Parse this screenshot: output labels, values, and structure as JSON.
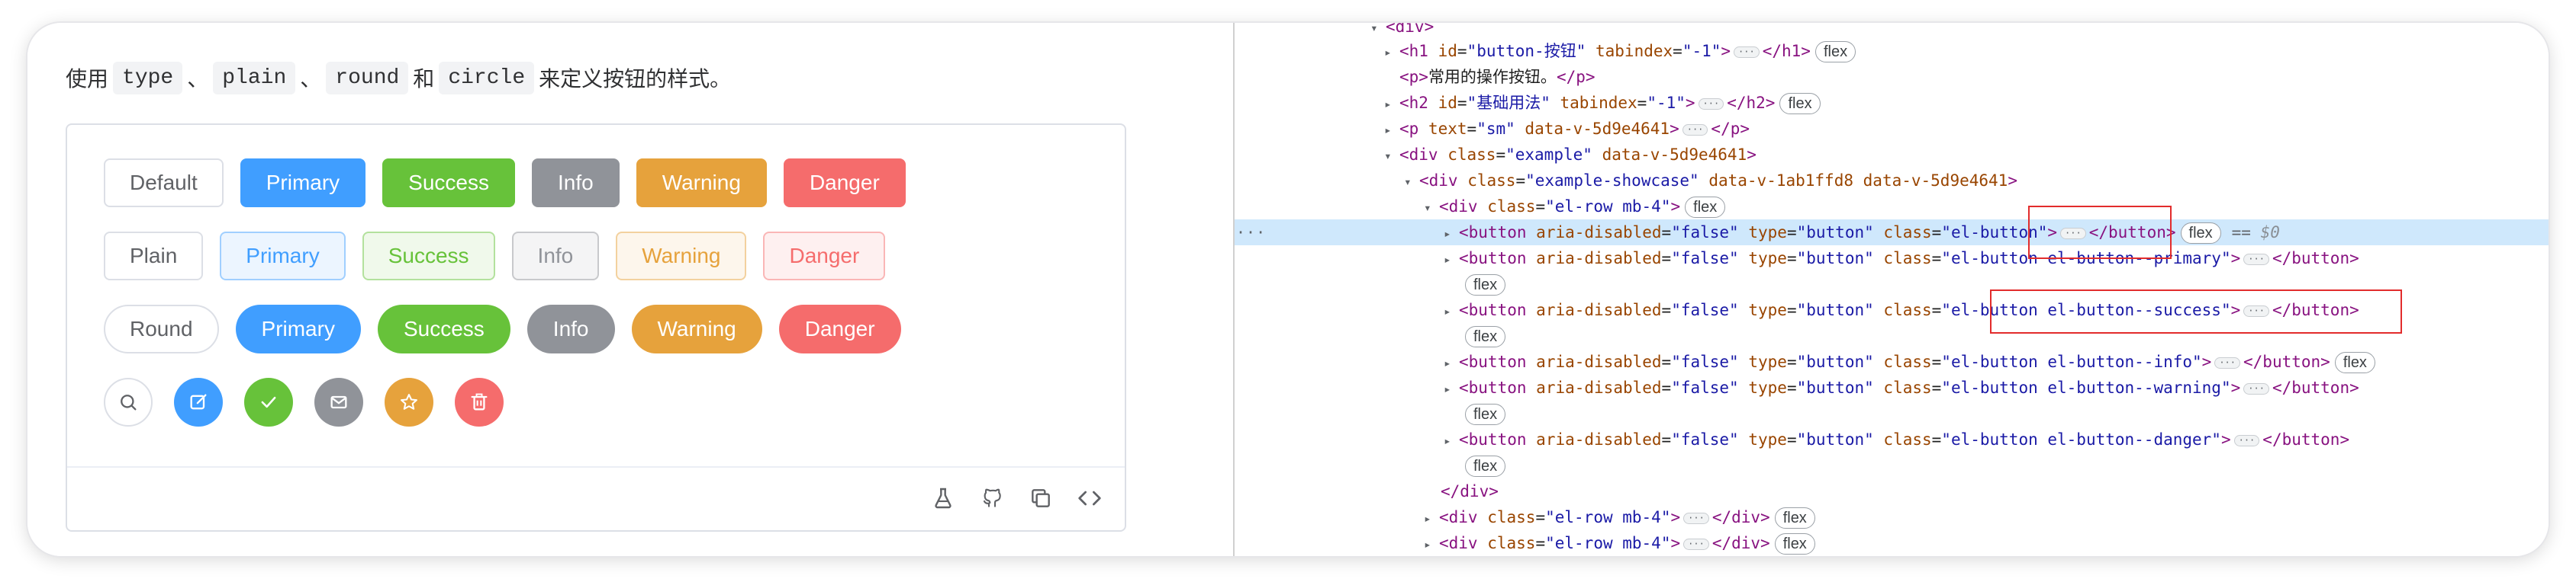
{
  "intro": {
    "pre": "使用",
    "sep1": "、",
    "sep2": "、",
    "sep3": "和",
    "post": "来定义按钮的样式。",
    "codes": [
      "type",
      "plain",
      "round",
      "circle"
    ]
  },
  "rows": {
    "basic": [
      "Default",
      "Primary",
      "Success",
      "Info",
      "Warning",
      "Danger"
    ],
    "plain": [
      "Plain",
      "Primary",
      "Success",
      "Info",
      "Warning",
      "Danger"
    ],
    "round": [
      "Round",
      "Primary",
      "Success",
      "Info",
      "Warning",
      "Danger"
    ],
    "circle_icons": [
      "search-icon",
      "edit-icon",
      "check-icon",
      "message-icon",
      "star-icon",
      "delete-icon"
    ]
  },
  "colors": {
    "primary": "#409eff",
    "success": "#67c23a",
    "info": "#909399",
    "warning": "#e6a23c",
    "danger": "#f56c6c",
    "selected_row": "#cfe8fc",
    "highlight_box": "#e22c2c"
  },
  "footer_icons": [
    "flask-icon",
    "github-icon",
    "copy-icon",
    "code-icon"
  ],
  "devtools": {
    "l0": "<div>",
    "l1": {
      "tag": "<h1",
      "attrs": [
        [
          "id",
          "\"button-按钮\""
        ],
        [
          "tabindex",
          "\"-1\""
        ]
      ],
      "close": "</h1>",
      "badge": "flex"
    },
    "l2": {
      "open": "<p>",
      "text": "常用的操作按钮。",
      "close": "</p>"
    },
    "l3": {
      "tag": "<h2",
      "attrs": [
        [
          "id",
          "\"基础用法\""
        ],
        [
          "tabindex",
          "\"-1\""
        ]
      ],
      "close": "</h2>",
      "badge": "flex"
    },
    "l4": {
      "tag": "<p",
      "attrs": [
        [
          "text",
          "\"sm\""
        ],
        [
          "data-v-5d9e4641",
          ""
        ]
      ],
      "close": "</p>"
    },
    "l5": {
      "tag": "<div",
      "attrs": [
        [
          "class",
          "\"example\""
        ],
        [
          "data-v-5d9e4641",
          ""
        ]
      ]
    },
    "l6": {
      "tag": "<div",
      "attrs": [
        [
          "class",
          "\"example-showcase\""
        ],
        [
          "data-v-1ab1ffd8",
          ""
        ],
        [
          "data-v-5d9e4641",
          ""
        ]
      ]
    },
    "l7": {
      "tag": "<div",
      "attrs": [
        [
          "class",
          "\"el-row mb-4\""
        ]
      ],
      "badge": "flex"
    },
    "buttons": [
      {
        "cls": "\"el-button\"",
        "badge": "flex",
        "eq": "==",
        "ref": "$0"
      },
      {
        "cls": "\"el-button el-button--primary\"",
        "badge": "flex"
      },
      {
        "cls": "\"el-button el-button--success\"",
        "badge": "flex"
      },
      {
        "cls": "\"el-button el-button--info\"",
        "badge": "flex"
      },
      {
        "cls": "\"el-button el-button--warning\"",
        "badge": "flex"
      },
      {
        "cls": "\"el-button el-button--danger\"",
        "badge": "flex"
      }
    ],
    "btn_prefix": {
      "tag": "<button",
      "a1": "aria-disabled",
      "v1": "\"false\"",
      "a2": "type",
      "v2": "\"button\"",
      "a3": "class",
      "close": "</button>"
    },
    "close_div": "</div>",
    "row2": {
      "tag": "<div",
      "attrs": [
        [
          "class",
          "\"el-row mb-4\""
        ]
      ],
      "close": "</div>",
      "badge": "flex"
    },
    "row3": {
      "tag": "<div",
      "attrs": [
        [
          "class",
          "\"el-row mb-4\""
        ]
      ],
      "close": "</div>",
      "badge": "flex"
    },
    "gutter": "···"
  }
}
